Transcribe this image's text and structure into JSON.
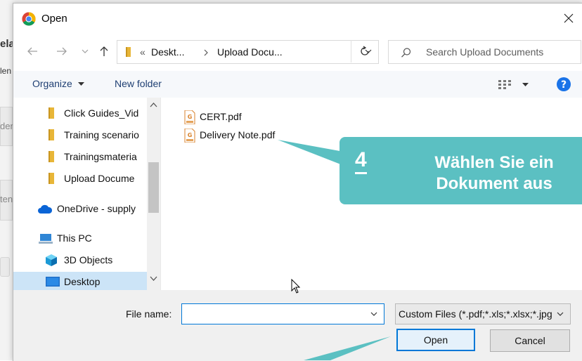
{
  "background": {
    "fragments": [
      "elac",
      "len",
      "den",
      "ten"
    ]
  },
  "dialog": {
    "title": "Open",
    "address": {
      "overflow_marker": "«",
      "crumbs": [
        "Deskt...",
        "Upload Docu..."
      ]
    },
    "search_placeholder": "Search Upload Documents",
    "toolbar": {
      "organize_label": "Organize",
      "new_folder_label": "New folder"
    },
    "nav_items": [
      {
        "label": "Click Guides_Vid",
        "icon": "folder-icon"
      },
      {
        "label": "Training scenario",
        "icon": "folder-icon"
      },
      {
        "label": "Trainingsmateria",
        "icon": "folder-icon"
      },
      {
        "label": "Upload Docume",
        "icon": "folder-icon"
      },
      {
        "label": "OneDrive - supply",
        "icon": "cloud-icon"
      },
      {
        "label": "This PC",
        "icon": "computer-icon"
      },
      {
        "label": "3D Objects",
        "icon": "cube-icon"
      },
      {
        "label": "Desktop",
        "icon": "desktop-icon",
        "selected": true
      }
    ],
    "files": [
      {
        "name": "CERT.pdf",
        "icon": "pdf-file-icon"
      },
      {
        "name": "Delivery Note.pdf",
        "icon": "pdf-file-icon"
      }
    ],
    "file_name_label": "File name:",
    "file_name_value": "",
    "file_type_filter": "Custom Files (*.pdf;*.xls;*.xlsx;*.jpg",
    "open_button": "Open",
    "cancel_button": "Cancel"
  },
  "callout": {
    "step_number": "4",
    "text_line1": "Wählen Sie ein",
    "text_line2": "Dokument aus"
  },
  "colors": {
    "callout": "#5bc0c2",
    "accent": "#0078d7",
    "selection": "#cce4f7",
    "link_text": "#1f3f73"
  }
}
